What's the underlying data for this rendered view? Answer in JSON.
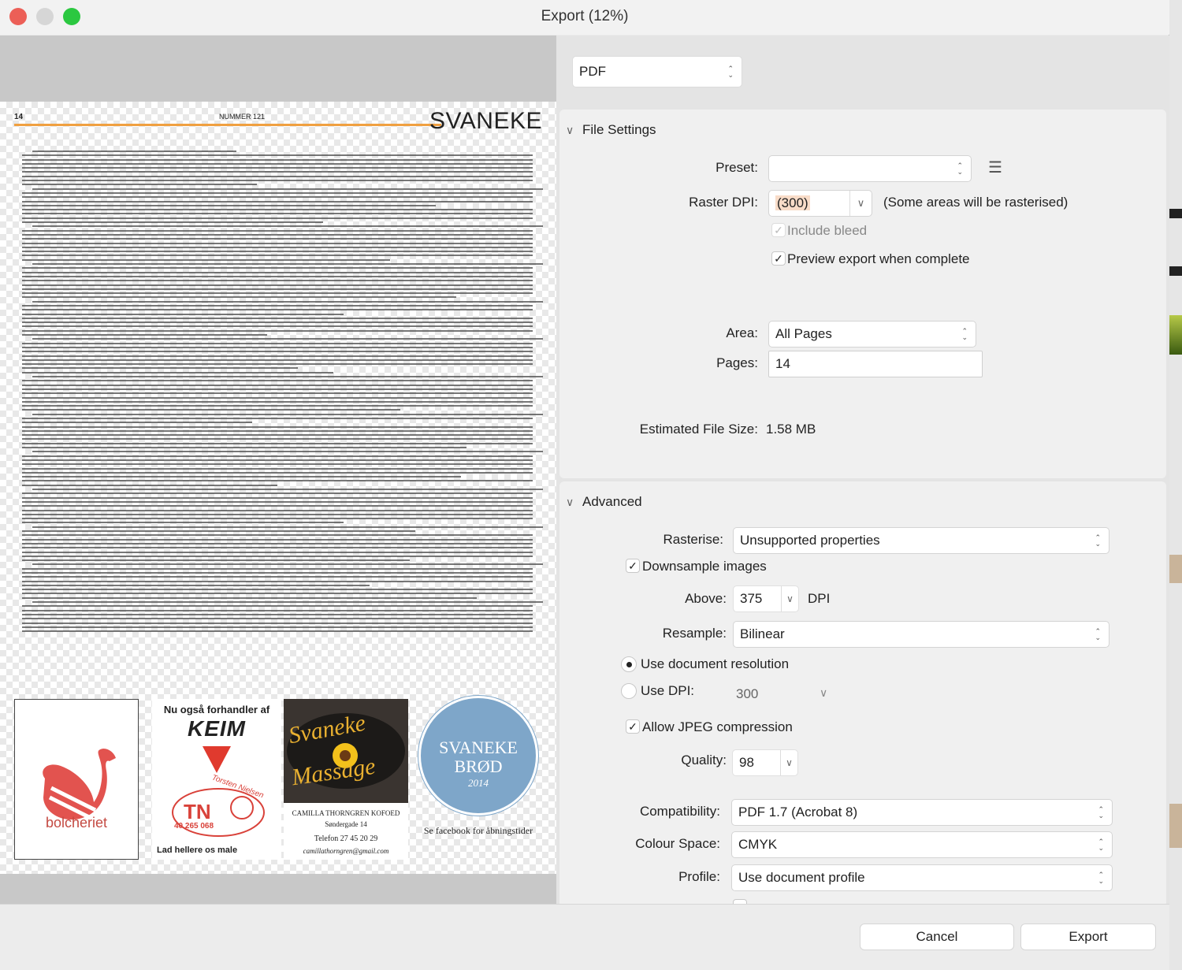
{
  "window": {
    "title": "Export (12%)"
  },
  "format": {
    "selected": "PDF"
  },
  "file_settings": {
    "header": "File Settings",
    "preset_label": "Preset:",
    "preset_value": "",
    "raster_dpi_label": "Raster DPI:",
    "raster_dpi_value": "(300)",
    "raster_note": "(Some areas will be rasterised)",
    "include_bleed": "Include bleed",
    "preview_export": "Preview export when complete",
    "area_label": "Area:",
    "area_value": "All Pages",
    "pages_label": "Pages:",
    "pages_value": "14",
    "est_size_label": "Estimated File Size:",
    "est_size_value": "1.58 MB"
  },
  "advanced": {
    "header": "Advanced",
    "rasterise_label": "Rasterise:",
    "rasterise_value": "Unsupported properties",
    "downsample": "Downsample images",
    "above_label": "Above:",
    "above_value": "375",
    "above_unit": "DPI",
    "resample_label": "Resample:",
    "resample_value": "Bilinear",
    "use_doc_res": "Use document resolution",
    "use_dpi": "Use DPI:",
    "use_dpi_value": "300",
    "allow_jpeg": "Allow JPEG compression",
    "quality_label": "Quality:",
    "quality_value": "98",
    "compat_label": "Compatibility:",
    "compat_value": "PDF 1.7 (Acrobat 8)",
    "colour_label": "Colour Space:",
    "colour_value": "CMYK",
    "profile_label": "Profile:",
    "profile_value": "Use document profile"
  },
  "buttons": {
    "cancel": "Cancel",
    "export": "Export"
  },
  "preview": {
    "page_number": "14",
    "issue": "NUMMER 121",
    "brand": "SVANEKE",
    "ad1_text": "bolcheriet",
    "ad2_title": "Nu også forhandler af",
    "ad2_logo": "KEIM",
    "ad2_brand": "Torsten Nielsen",
    "ad2_phone": "40 265 068",
    "ad2_footer": "Lad hellere os male",
    "ad3_line1": "Svaneke",
    "ad3_line2": "Massage",
    "ad3_name": "CAMILLA THORNGREN KOFOED",
    "ad3_addr": "Søndergade 14",
    "ad3_phone": "Telefon 27 45 20 29",
    "ad3_email": "camillathorngren@gmail.com",
    "ad4_line1": "SVANEKE",
    "ad4_line2": "BRØD",
    "ad4_year": "2014",
    "ad4_caption": "Se facebook for åbningstider"
  },
  "colors": {
    "close": "#ec5f57",
    "minimize": "#d6d6d6",
    "zoom": "#2bc840",
    "accent_rule": "#f0a040",
    "swan": "#e2534f",
    "bread_blue": "#7ea6c9"
  }
}
